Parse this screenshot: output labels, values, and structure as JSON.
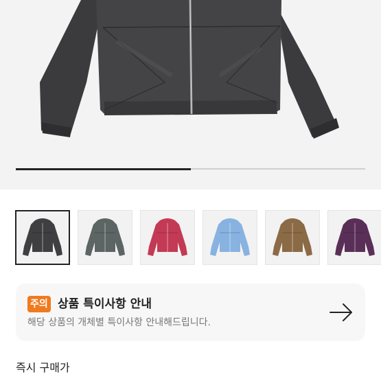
{
  "gallery": {
    "progress_fraction": 0.5,
    "selected_index": 0,
    "thumbnails": [
      {
        "color": "#3f3f42",
        "name": "charcoal"
      },
      {
        "color": "#5c6563",
        "name": "gray-green"
      },
      {
        "color": "#c33a55",
        "name": "berry-red"
      },
      {
        "color": "#88b2e0",
        "name": "sky-blue"
      },
      {
        "color": "#8b6a46",
        "name": "brown"
      },
      {
        "color": "#5a2f57",
        "name": "purple"
      }
    ]
  },
  "notice": {
    "badge": "주의",
    "title": "상품 특이사항 안내",
    "description": "해당 상품의 개체별 특이사항 안내해드립니다.",
    "arrow_icon": "arrow-right-icon",
    "badge_color": "#f07a1e"
  },
  "purchase": {
    "section_title": "즉시 구매가"
  }
}
